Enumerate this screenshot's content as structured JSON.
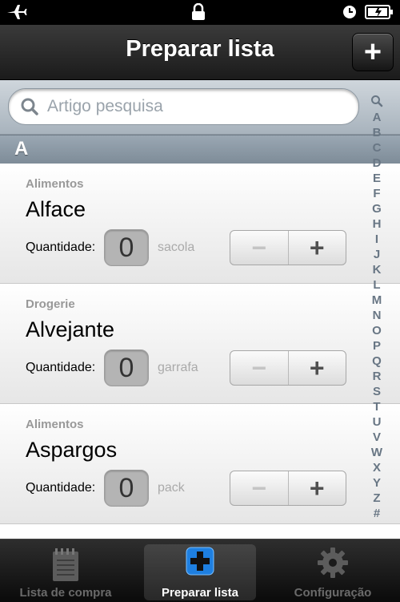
{
  "status_bar": {
    "left_icon": "airplane-icon",
    "center_icon": "lock-icon",
    "right_icons": [
      "clock-icon",
      "battery-icon"
    ]
  },
  "nav": {
    "title": "Preparar lista",
    "add_label": "+"
  },
  "search": {
    "placeholder": "Artigo pesquisa"
  },
  "section": {
    "letter": "A"
  },
  "items": [
    {
      "category": "Alimentos",
      "name": "Alface",
      "qty_label": "Quantidade:",
      "qty": "0",
      "unit": "sacola",
      "minus": "−",
      "plus": "+"
    },
    {
      "category": "Drogerie",
      "name": "Alvejante",
      "qty_label": "Quantidade:",
      "qty": "0",
      "unit": "garrafa",
      "minus": "−",
      "plus": "+"
    },
    {
      "category": "Alimentos",
      "name": "Aspargos",
      "qty_label": "Quantidade:",
      "qty": "0",
      "unit": "pack",
      "minus": "−",
      "plus": "+"
    }
  ],
  "index": [
    "A",
    "B",
    "C",
    "D",
    "E",
    "F",
    "G",
    "H",
    "I",
    "J",
    "K",
    "L",
    "M",
    "N",
    "O",
    "P",
    "Q",
    "R",
    "S",
    "T",
    "U",
    "V",
    "W",
    "X",
    "Y",
    "Z",
    "#"
  ],
  "tabs": [
    {
      "label": "Lista de compra",
      "icon": "notepad-icon",
      "active": false
    },
    {
      "label": "Preparar lista",
      "icon": "add-icon",
      "active": true
    },
    {
      "label": "Configuração",
      "icon": "gear-icon",
      "active": false
    }
  ],
  "colors": {
    "nav_bg": "#2a2a2a",
    "section_bg": "#8a97a3",
    "index_text": "#687684",
    "tab_active_icon": "#1e7fe0"
  }
}
